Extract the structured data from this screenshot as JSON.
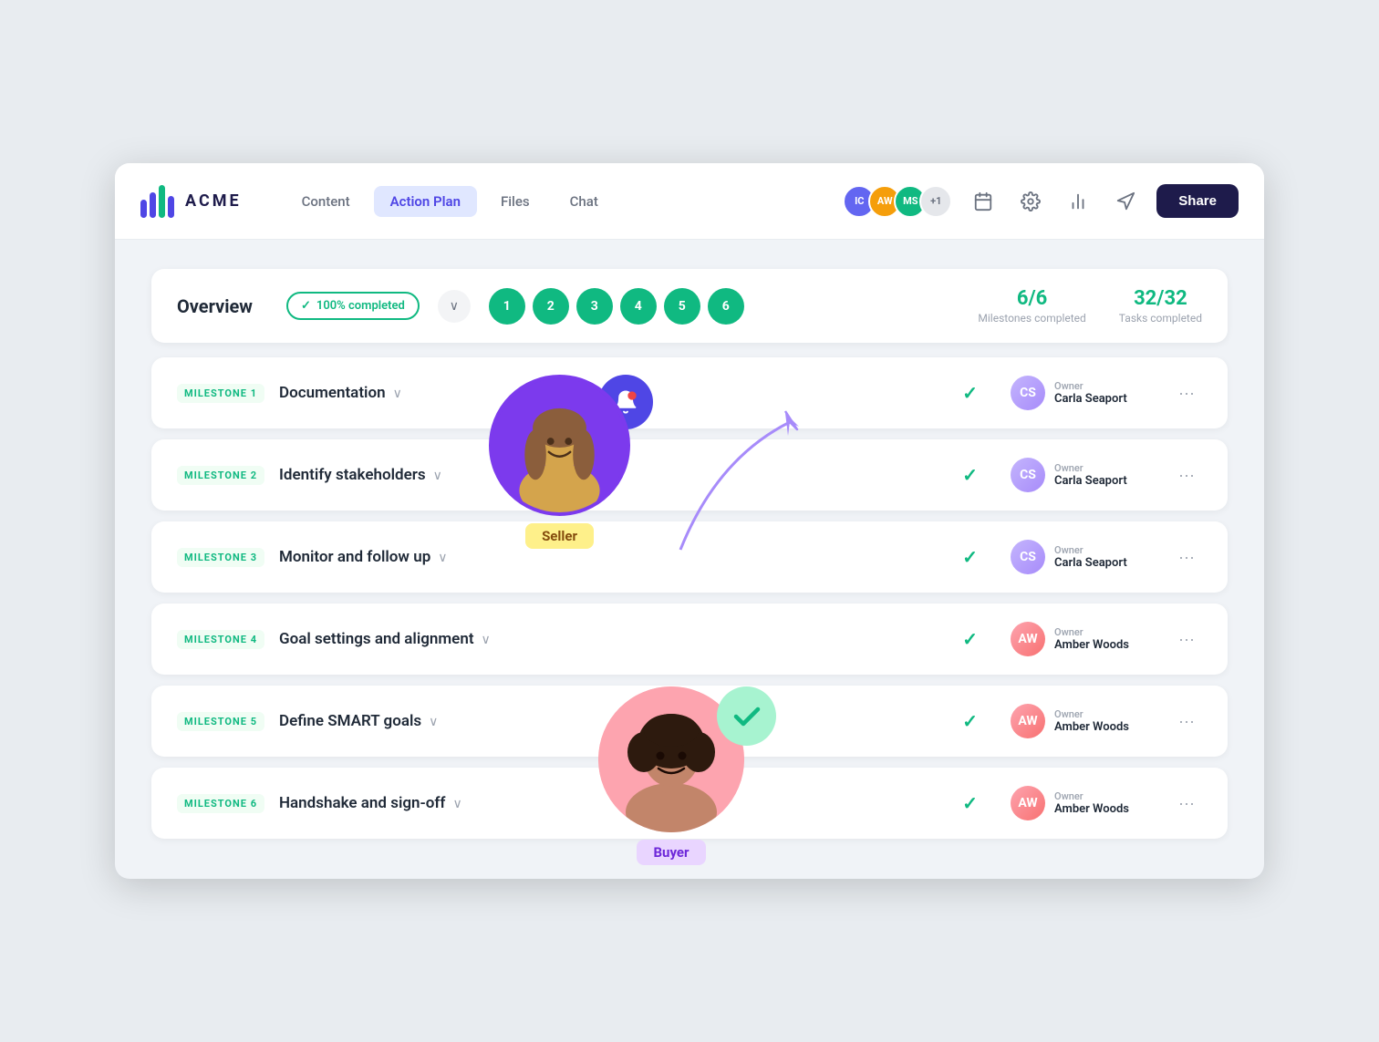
{
  "app": {
    "logo_text": "ACME"
  },
  "nav": {
    "items": [
      {
        "label": "Content",
        "active": false
      },
      {
        "label": "Action Plan",
        "active": true
      },
      {
        "label": "Files",
        "active": false
      },
      {
        "label": "Chat",
        "active": false
      }
    ]
  },
  "header": {
    "avatars": [
      {
        "initials": "IC",
        "color": "#6366f1"
      },
      {
        "initials": "AW",
        "color": "#f59e0b"
      },
      {
        "initials": "MS",
        "color": "#10b981"
      },
      {
        "initials": "+1",
        "color": "#e5e7eb"
      }
    ],
    "share_label": "Share"
  },
  "overview": {
    "title": "Overview",
    "completed_label": "100% completed",
    "milestones": [
      "1",
      "2",
      "3",
      "4",
      "5",
      "6"
    ],
    "milestones_completed": "6/6",
    "milestones_label": "Milestones completed",
    "tasks_completed": "32/32",
    "tasks_label": "Tasks completed"
  },
  "milestones": [
    {
      "tag": "MILESTONE 1",
      "name": "Documentation",
      "owner_label": "Owner",
      "owner_name": "Carla Seaport",
      "owner_type": "seaport"
    },
    {
      "tag": "MILESTONE 2",
      "name": "Identify stakeholders",
      "owner_label": "Owner",
      "owner_name": "Carla Seaport",
      "owner_type": "seaport"
    },
    {
      "tag": "MILESTONE 3",
      "name": "Monitor and follow up",
      "owner_label": "Owner",
      "owner_name": "Carla Seaport",
      "owner_type": "seaport"
    },
    {
      "tag": "MILESTONE 4",
      "name": "Goal settings and alignment",
      "owner_label": "Owner",
      "owner_name": "Amber Woods",
      "owner_type": "woods"
    },
    {
      "tag": "MILESTONE 5",
      "name": "Define SMART goals",
      "owner_label": "Owner",
      "owner_name": "Amber Woods",
      "owner_type": "woods"
    },
    {
      "tag": "MILESTONE 6",
      "name": "Handshake and sign-off",
      "owner_label": "Owner",
      "owner_name": "Amber Woods",
      "owner_type": "woods"
    }
  ],
  "overlays": {
    "seller_label": "Seller",
    "buyer_label": "Buyer"
  }
}
